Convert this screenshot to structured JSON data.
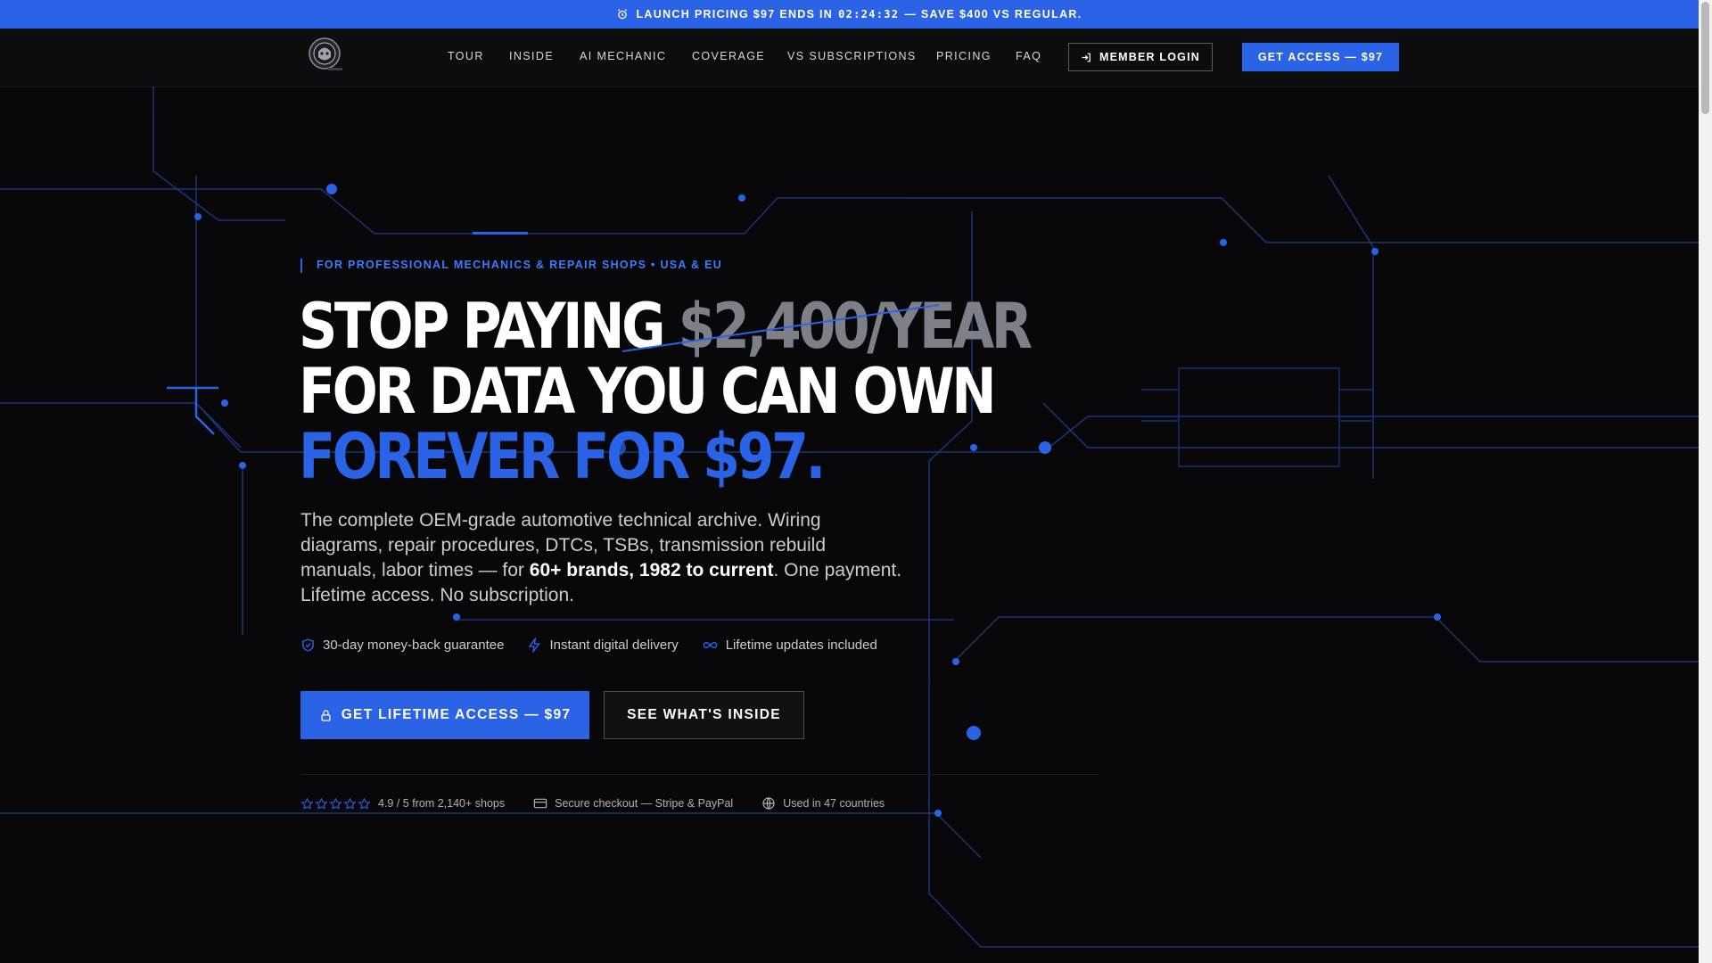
{
  "promo": {
    "prefix": "LAUNCH PRICING $97 ENDS IN",
    "timer": "02:24:32",
    "suffix": "— SAVE $400 VS REGULAR."
  },
  "nav": {
    "links": [
      "TOUR",
      "INSIDE",
      "AI MECHANIC",
      "COVERAGE",
      "VS SUBSCRIPTIONS",
      "PRICING",
      "FAQ"
    ],
    "login_label": "MEMBER LOGIN",
    "access_label": "GET ACCESS — $97"
  },
  "hero": {
    "eyebrow": "FOR PROFESSIONAL MECHANICS & REPAIR SHOPS • USA & EU",
    "headline_line1_prefix": "STOP PAYING",
    "headline_line1_strike": "$2,400/YEAR",
    "headline_line2": "FOR DATA YOU CAN OWN",
    "headline_line3": "FOREVER FOR $97.",
    "lead_part1": "The complete OEM-grade automotive technical archive. Wiring diagrams, repair procedures, DTCs, TSBs, transmission rebuild manuals, labor times — for",
    "lead_highlight": "60+ brands, 1982 to current",
    "lead_part2": ". One payment. Lifetime access. No subscription.",
    "features": [
      {
        "icon": "shield-check-icon",
        "label": "30-day money-back guarantee"
      },
      {
        "icon": "lightning-icon",
        "label": "Instant digital delivery"
      },
      {
        "icon": "infinity-icon",
        "label": "Lifetime updates included"
      }
    ],
    "cta_primary": "GET LIFETIME ACCESS — $97",
    "cta_secondary": "SEE WHAT'S INSIDE",
    "rating": {
      "stars": 5,
      "text": "4.9 / 5 from 2,140+ shops"
    },
    "checkout": "Secure checkout — Stripe & PayPal",
    "countries": "Used in 47 countries"
  },
  "colors": {
    "accent": "#2b63e6",
    "background": "#08080a",
    "muted_strike": "#7d8089"
  }
}
